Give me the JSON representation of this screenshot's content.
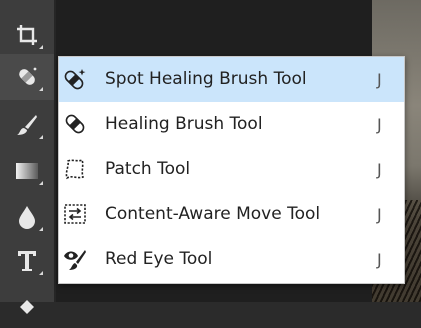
{
  "toolbar": {
    "tools": [
      {
        "icon": "crop-icon"
      },
      {
        "icon": "spot-healing-brush-icon",
        "active": true
      },
      {
        "icon": "brush-icon"
      },
      {
        "icon": "gradient-icon"
      },
      {
        "icon": "blur-drop-icon"
      },
      {
        "icon": "type-icon",
        "glyph": "T"
      },
      {
        "icon": "pen-icon"
      }
    ]
  },
  "flyout_menu": {
    "items": [
      {
        "label": "Spot Healing Brush Tool",
        "shortcut": "J",
        "icon": "spot-healing-brush-icon",
        "selected": true
      },
      {
        "label": "Healing Brush Tool",
        "shortcut": "J",
        "icon": "healing-brush-icon",
        "selected": false
      },
      {
        "label": "Patch Tool",
        "shortcut": "J",
        "icon": "patch-icon",
        "selected": false
      },
      {
        "label": "Content-Aware Move Tool",
        "shortcut": "J",
        "icon": "content-aware-move-icon",
        "selected": false
      },
      {
        "label": "Red Eye Tool",
        "shortcut": "J",
        "icon": "red-eye-icon",
        "selected": false
      }
    ]
  },
  "colors": {
    "toolbar_bg": "#3d3d3d",
    "menu_bg": "#ffffff",
    "menu_selected_bg": "#cbe5fb",
    "menu_text": "#222222"
  }
}
